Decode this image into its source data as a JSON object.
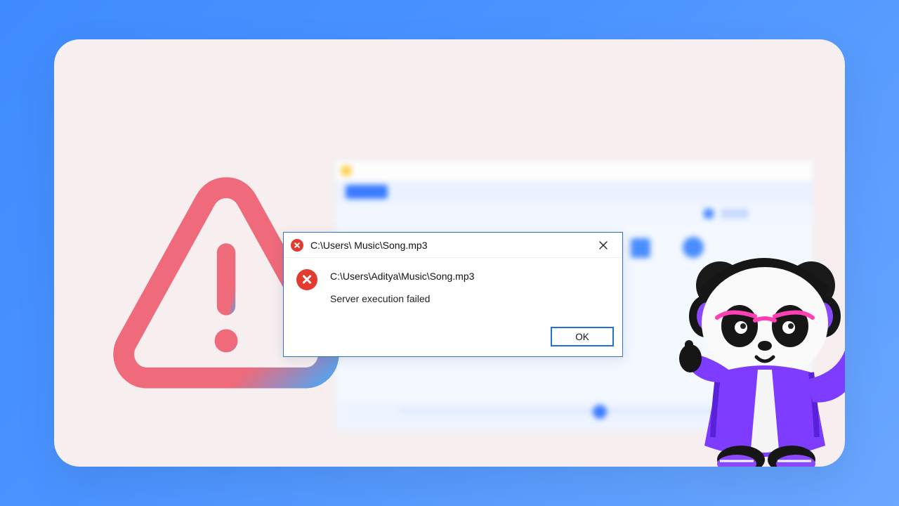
{
  "colors": {
    "page_bg_from": "#3f8cff",
    "page_bg_to": "#6aa7ff",
    "card_bg": "#f7efef",
    "dialog_border": "#2f6fc5",
    "error_red": "#e33b2e",
    "ok_border": "#1e6fd6",
    "warn_grad_from": "#ef6a7a",
    "warn_grad_to": "#5aa1ea"
  },
  "dialog": {
    "title": "C:\\Users\\ Music\\Song.mp3",
    "path": "C:\\Users\\Aditya\\Music\\Song.mp3",
    "message": "Server execution failed",
    "ok_label": "OK"
  },
  "icons": {
    "title_error": "error-circle-icon",
    "body_error": "error-circle-icon",
    "close": "close-icon",
    "warning_triangle": "warning-triangle-icon",
    "mascot": "panda-mascot"
  }
}
